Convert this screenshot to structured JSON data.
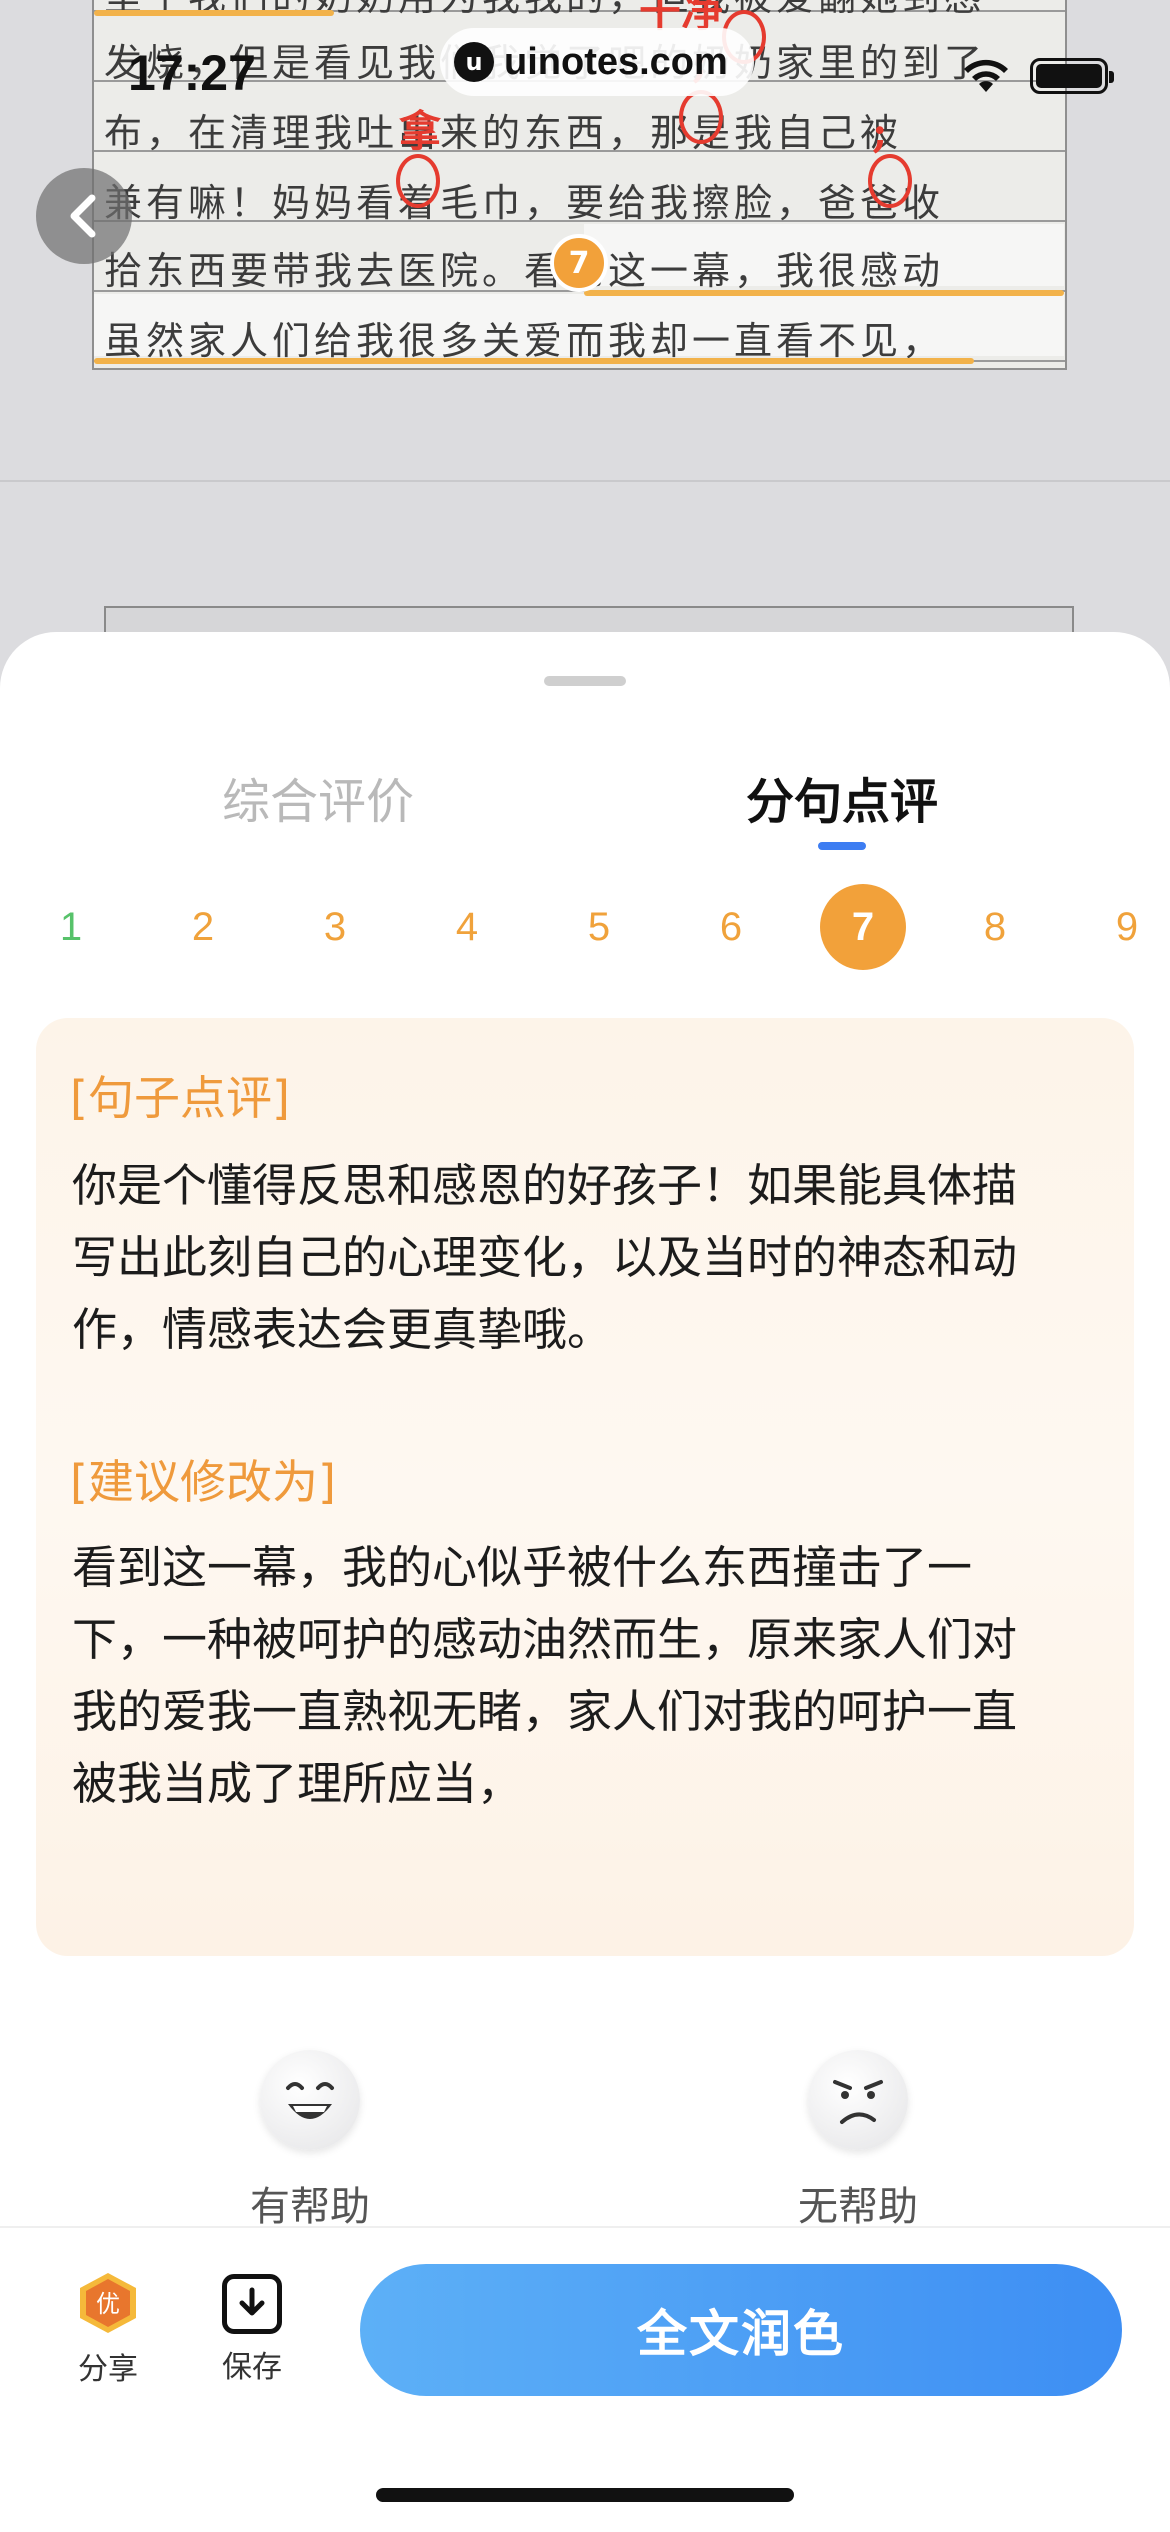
{
  "status_bar": {
    "time": "17:27"
  },
  "watermark": {
    "icon": "u",
    "text": "uinotes.com"
  },
  "essay": {
    "rows": [
      "里子我们的奶奶用为我我的，但我被爱翻她到感",
      "发烧，但是看见我们我觉了吧的奶奶家里的到了",
      "布，在清理我吐出来的东西，那是我自己被",
      "兼有嘛！妈妈看着毛巾，要给我擦脸，爸爸收",
      "拾东西要带我去医院。看到这一幕，我很感动",
      "虽然家人们给我很多关爱而我却一直看不见，"
    ],
    "corrections": [
      "干净",
      "拿",
      ";",
      ";"
    ],
    "marker": "7"
  },
  "tabs": [
    {
      "label": "综合评价",
      "active": false
    },
    {
      "label": "分句点评",
      "active": true
    }
  ],
  "sentence_numbers": [
    "1",
    "2",
    "3",
    "4",
    "5",
    "6",
    "7",
    "8",
    "9"
  ],
  "active_sentence": "7",
  "review": {
    "comment_heading": "[句子点评]",
    "comment_lines": [
      "你是个懂得反思和感恩的好孩子！如果能具体描",
      "写出此刻自己的心理变化，以及当时的神态和动",
      "作，情感表达会更真挚哦。"
    ],
    "suggest_heading": "[建议修改为]",
    "suggest_lines": [
      "看到这一幕，我的心似乎被什么东西撞击了一",
      "下，一种被呵护的感动油然而生，原来家人们对",
      "我的爱我一直熟视无睹，家人们对我的呵护一直",
      "被我当成了理所应当，"
    ]
  },
  "feedback": {
    "helpful": "有帮助",
    "not_helpful": "无帮助"
  },
  "bottom_bar": {
    "share_label": "分享",
    "share_badge": "优",
    "save_label": "保存",
    "cta_label": "全文润色"
  }
}
